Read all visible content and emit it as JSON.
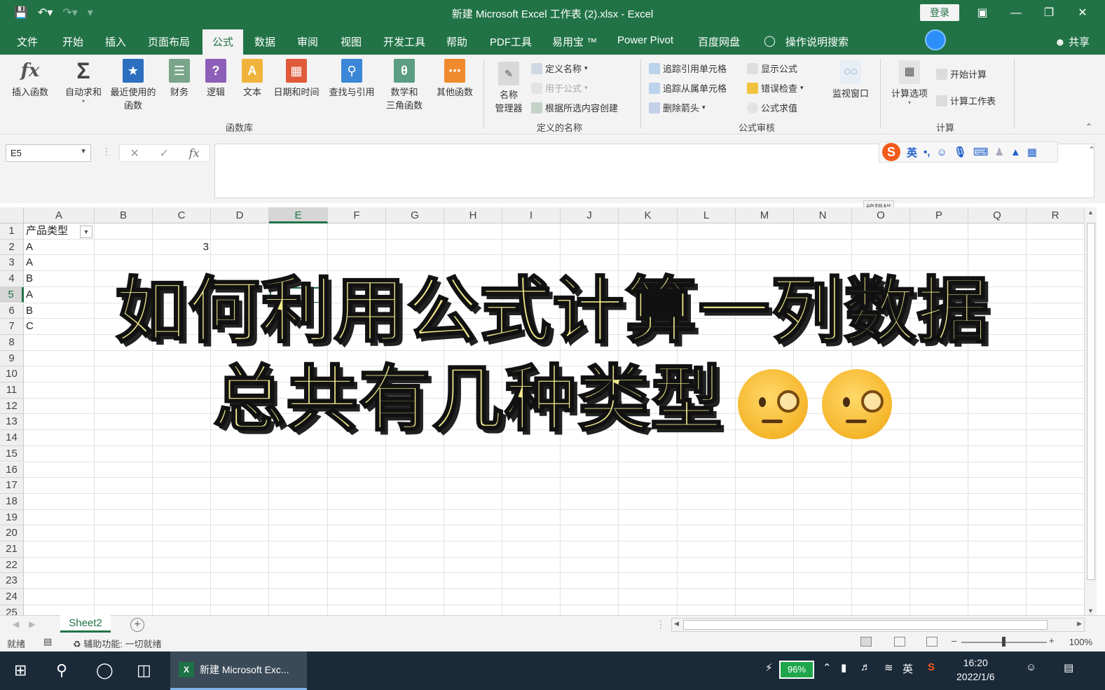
{
  "title_bar": {
    "window_title": "新建 Microsoft Excel 工作表 (2).xlsx  -  Excel",
    "login_label": "登录",
    "save_icon": "save-icon",
    "undo_icon": "undo-icon",
    "redo_icon": "redo-icon"
  },
  "tabs": [
    "文件",
    "开始",
    "插入",
    "页面布局",
    "公式",
    "数据",
    "审阅",
    "视图",
    "开发工具",
    "帮助",
    "PDF工具",
    "易用宝 ™",
    "Power Pivot",
    "百度网盘"
  ],
  "active_tab": "公式",
  "tell_me": "操作说明搜索",
  "share_label": "共享",
  "ribbon": {
    "function_library": {
      "label": "函数库",
      "insert_function": "插入函数",
      "autosum": "自动求和",
      "recent_line1": "最近使用的",
      "recent_line2": "函数",
      "financial": "财务",
      "logical": "逻辑",
      "text": "文本",
      "datetime": "日期和时间",
      "lookup": "查找与引用",
      "math_line1": "数学和",
      "math_line2": "三角函数",
      "more": "其他函数"
    },
    "defined_names": {
      "label": "定义的名称",
      "name_manager_line1": "名称",
      "name_manager_line2": "管理器",
      "define_name": "定义名称",
      "use_in_formula": "用于公式",
      "create_from_selection": "根据所选内容创建"
    },
    "formula_auditing": {
      "label": "公式审核",
      "trace_precedents": "追踪引用单元格",
      "trace_dependents": "追踪从属单元格",
      "remove_arrows": "删除箭头",
      "show_formulas": "显示公式",
      "error_checking": "错误检查",
      "evaluate_formula": "公式求值",
      "watch_window": "监视窗口"
    },
    "calculation": {
      "label": "计算",
      "options": "计算选项",
      "calc_now": "开始计算",
      "calc_sheet": "计算工作表"
    }
  },
  "formula_bar": {
    "name_box": "E5",
    "formula": "",
    "tooltip": "编辑栏",
    "ime_lang": "英"
  },
  "columns": [
    "A",
    "B",
    "C",
    "D",
    "E",
    "F",
    "G",
    "H",
    "I",
    "J",
    "K",
    "L",
    "M",
    "N",
    "O",
    "P",
    "Q",
    "R"
  ],
  "selected_column": "E",
  "rows": [
    "1",
    "2",
    "3",
    "4",
    "5",
    "6",
    "7",
    "8",
    "9",
    "10",
    "11",
    "12",
    "13",
    "14",
    "15",
    "16",
    "17",
    "18",
    "19",
    "20",
    "21",
    "22",
    "23",
    "24",
    "25"
  ],
  "selected_row": "5",
  "cells": {
    "A1": "产品类型",
    "A2": "A",
    "A3": "A",
    "A4": "B",
    "A5": "A",
    "A6": "B",
    "A7": "C",
    "C2": "3"
  },
  "overlay": {
    "line1": "如何利用公式计算一列数据",
    "line2": "总共有几种类型",
    "emoji": "face-with-monocle-icon"
  },
  "sheet_tab": "Sheet2",
  "status": {
    "ready": "就绪",
    "accessibility": "辅助功能: 一切就绪",
    "zoom": "100%"
  },
  "taskbar": {
    "app_label": "新建 Microsoft Exc...",
    "battery": "96%",
    "ime": "英",
    "time": "16:20",
    "date": "2022/1/6"
  }
}
